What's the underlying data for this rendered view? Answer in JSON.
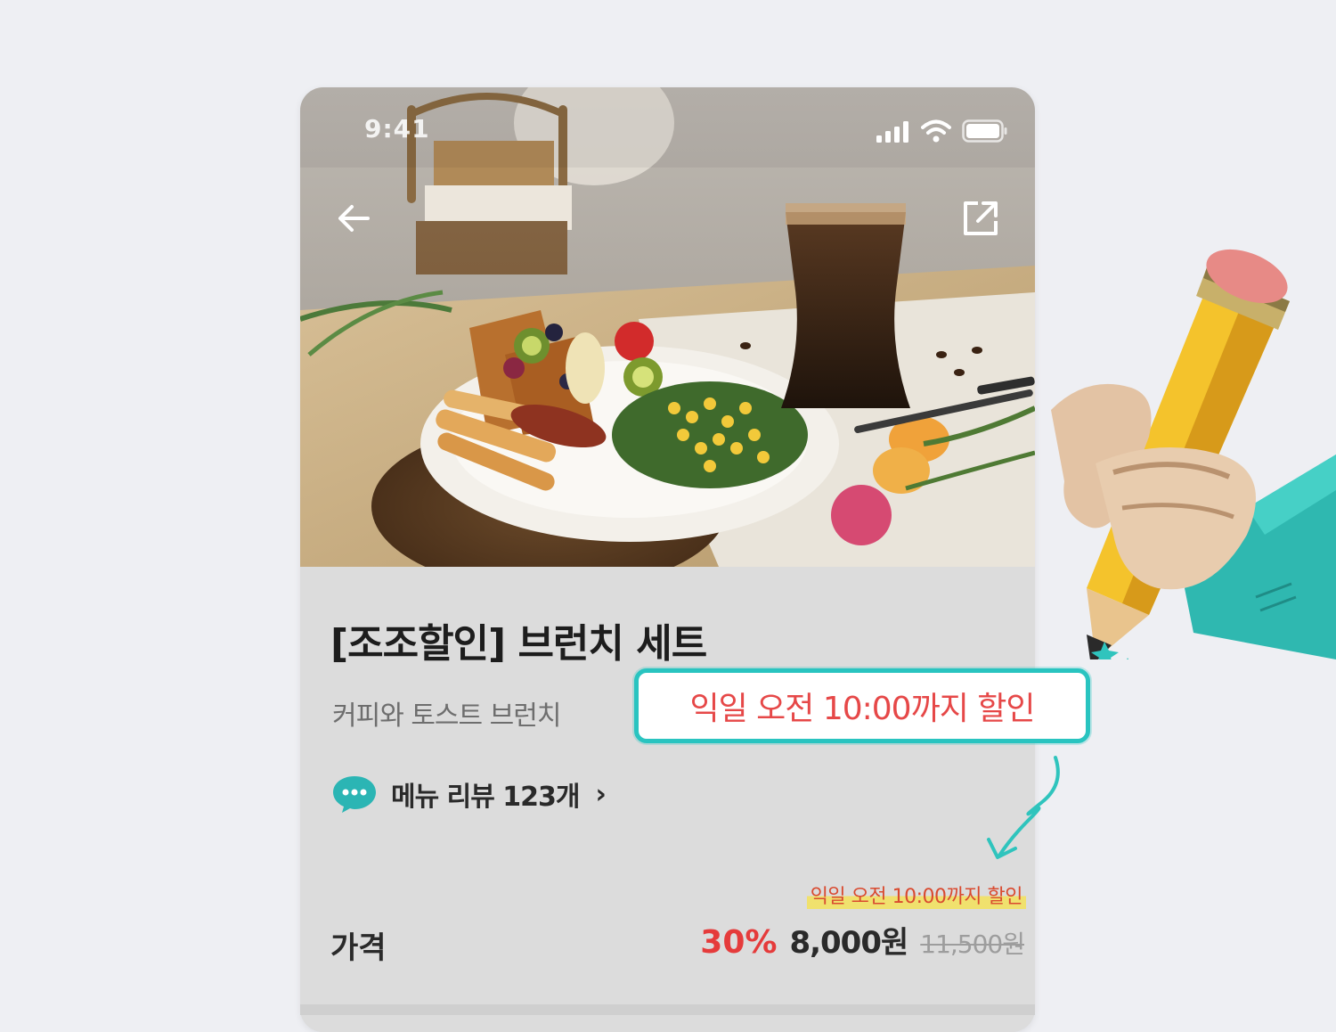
{
  "status_bar": {
    "time": "9:41"
  },
  "icons": {
    "back": "back-arrow-icon",
    "share": "share-icon",
    "review": "chat-bubble-icon",
    "signal": "signal-icon",
    "wifi": "wifi-icon",
    "battery": "battery-icon"
  },
  "product": {
    "title": "[조조할인] 브런치 세트",
    "subtitle": "커피와 토스트 브런치",
    "review_label": "메뉴 리뷰 123개",
    "review_chevron": "›"
  },
  "pricing": {
    "label": "가격",
    "discount": "30%",
    "price": "8,000원",
    "original": "11,500원",
    "note": "익일 오전 10:00까지 할인"
  },
  "callout": {
    "text": "익일 오전 10:00까지 할인"
  },
  "colors": {
    "accent_teal": "#29c4c0",
    "discount_red": "#e53b3b",
    "highlight_yellow": "#f4e25a"
  }
}
